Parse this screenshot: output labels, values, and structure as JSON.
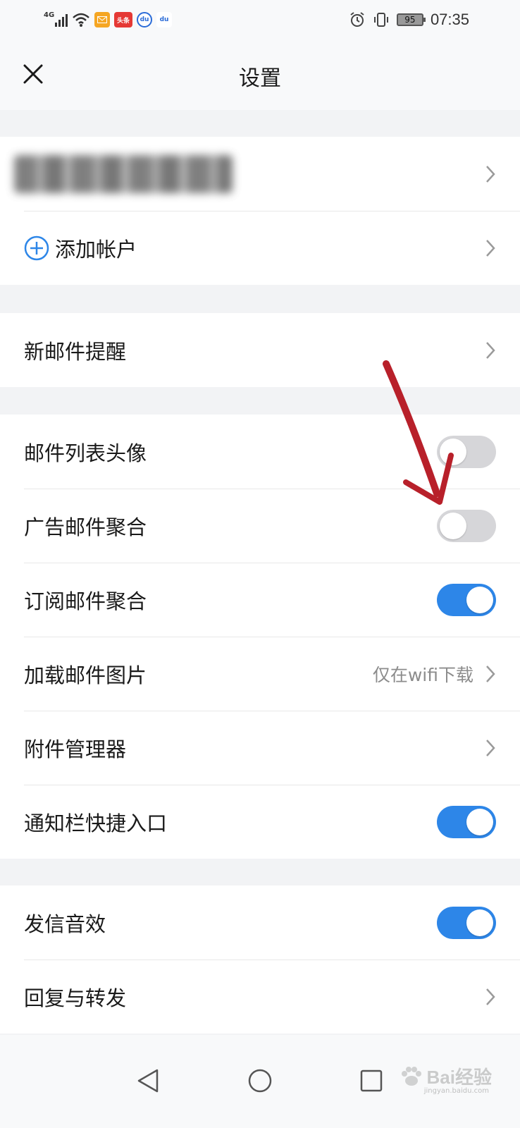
{
  "status_bar": {
    "network_type": "4G",
    "app_icons": [
      "mail-app-icon",
      "toutiao-icon",
      "baidu-icon",
      "baidu-small-icon"
    ],
    "toutiao_text": "头条",
    "baidu_text": "du",
    "battery_level": "95",
    "time": "07:35"
  },
  "header": {
    "title": "设置"
  },
  "account_group": {
    "add_account_label": "添加帐户"
  },
  "notify_group": {
    "new_mail_label": "新邮件提醒"
  },
  "settings_group": {
    "items": [
      {
        "label": "邮件列表头像",
        "type": "toggle",
        "on": false
      },
      {
        "label": "广告邮件聚合",
        "type": "toggle",
        "on": false
      },
      {
        "label": "订阅邮件聚合",
        "type": "toggle",
        "on": true
      },
      {
        "label": "加载邮件图片",
        "type": "link",
        "value": "仅在wifi下载"
      },
      {
        "label": "附件管理器",
        "type": "link"
      },
      {
        "label": "通知栏快捷入口",
        "type": "toggle",
        "on": true
      }
    ]
  },
  "sound_group": {
    "items": [
      {
        "label": "发信音效",
        "type": "toggle",
        "on": true
      },
      {
        "label": "回复与转发",
        "type": "link"
      }
    ]
  },
  "colors": {
    "toggle_on": "#2d86e8",
    "toggle_off": "#d6d6d9",
    "annotation_arrow": "#c0262d"
  },
  "watermark": {
    "text": "Bai经验",
    "sub": "jingyan.baidu.com"
  }
}
